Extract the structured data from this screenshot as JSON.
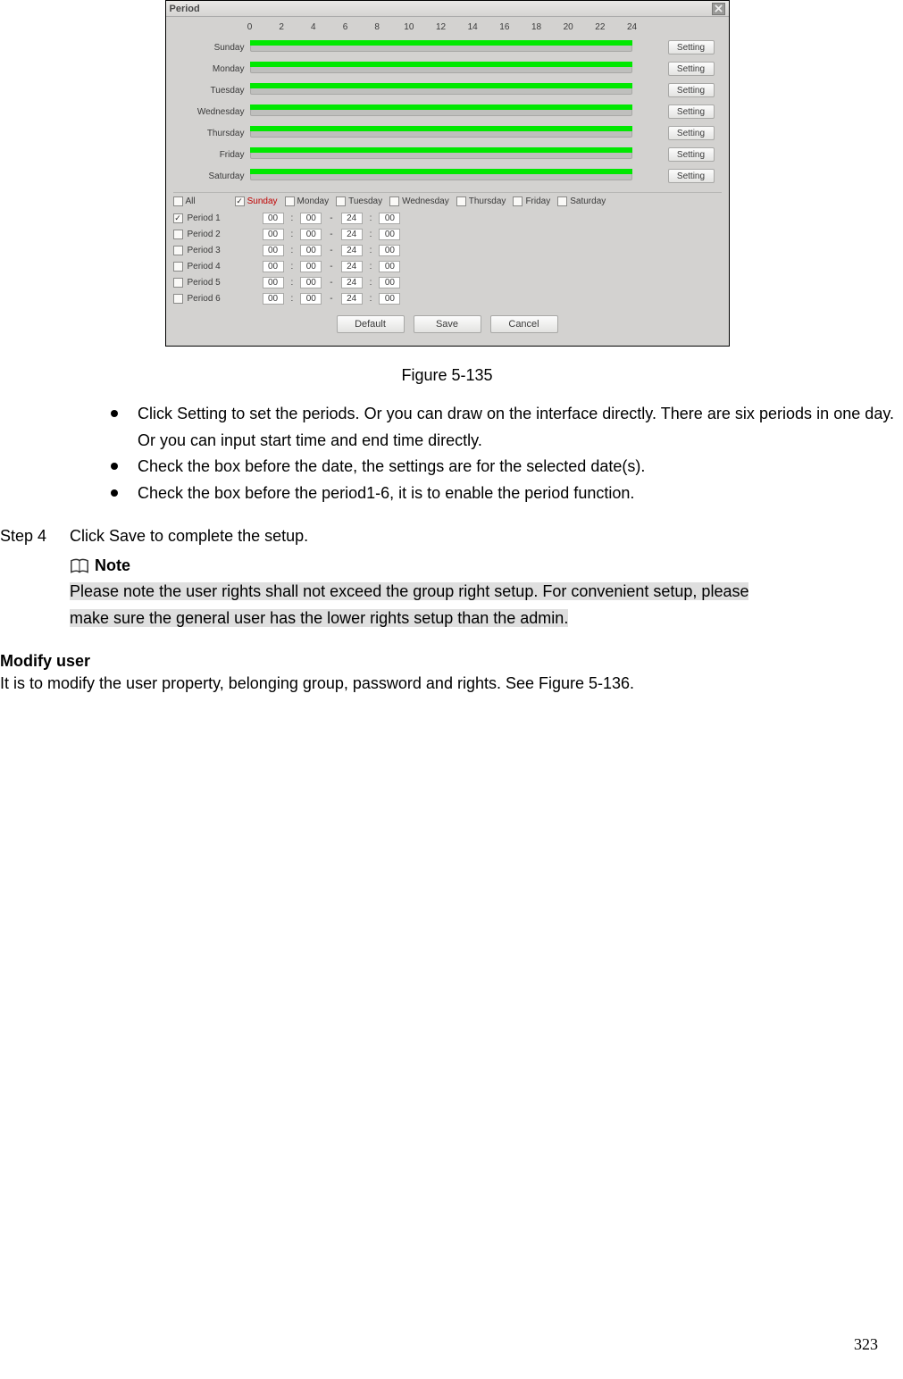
{
  "dialog": {
    "title": "Period",
    "axis_ticks": [
      "0",
      "2",
      "4",
      "6",
      "8",
      "10",
      "12",
      "14",
      "16",
      "18",
      "20",
      "22",
      "24"
    ],
    "days": [
      "Sunday",
      "Monday",
      "Tuesday",
      "Wednesday",
      "Thursday",
      "Friday",
      "Saturday"
    ],
    "setting_label": "Setting",
    "week_select": {
      "all": {
        "label": "All",
        "checked": false
      },
      "items": [
        {
          "label": "Sunday",
          "checked": true,
          "highlight": true
        },
        {
          "label": "Monday",
          "checked": false
        },
        {
          "label": "Tuesday",
          "checked": false
        },
        {
          "label": "Wednesday",
          "checked": false
        },
        {
          "label": "Thursday",
          "checked": false
        },
        {
          "label": "Friday",
          "checked": false
        },
        {
          "label": "Saturday",
          "checked": false
        }
      ]
    },
    "periods": [
      {
        "label": "Period 1",
        "checked": true,
        "start_h": "00",
        "start_m": "00",
        "end_h": "24",
        "end_m": "00"
      },
      {
        "label": "Period 2",
        "checked": false,
        "start_h": "00",
        "start_m": "00",
        "end_h": "24",
        "end_m": "00"
      },
      {
        "label": "Period 3",
        "checked": false,
        "start_h": "00",
        "start_m": "00",
        "end_h": "24",
        "end_m": "00"
      },
      {
        "label": "Period 4",
        "checked": false,
        "start_h": "00",
        "start_m": "00",
        "end_h": "24",
        "end_m": "00"
      },
      {
        "label": "Period 5",
        "checked": false,
        "start_h": "00",
        "start_m": "00",
        "end_h": "24",
        "end_m": "00"
      },
      {
        "label": "Period 6",
        "checked": false,
        "start_h": "00",
        "start_m": "00",
        "end_h": "24",
        "end_m": "00"
      }
    ],
    "buttons": {
      "default": "Default",
      "save": "Save",
      "cancel": "Cancel"
    }
  },
  "doc": {
    "figure_caption": "Figure 5-135",
    "bullet1": "Click Setting to set the periods. Or you can draw on the interface directly. There are six periods in one day. Or you can input start time and end time directly.",
    "bullet2": "Check the box before the date, the settings are for the selected date(s).",
    "bullet3": "Check the box before the period1-6, it is to enable the period function.",
    "step4_label": "Step 4",
    "step4_text": "Click Save to complete the setup.",
    "note_heading": "Note",
    "note_line1": "Please note the user rights shall not exceed the group right setup. For convenient setup, please",
    "note_line2": "make sure the general user has the lower rights setup than the admin.  ",
    "modify_user_heading": "Modify user",
    "modify_user_text": "It is to modify the user property, belonging group, password and rights. See Figure 5-136.",
    "page_number": "323"
  }
}
